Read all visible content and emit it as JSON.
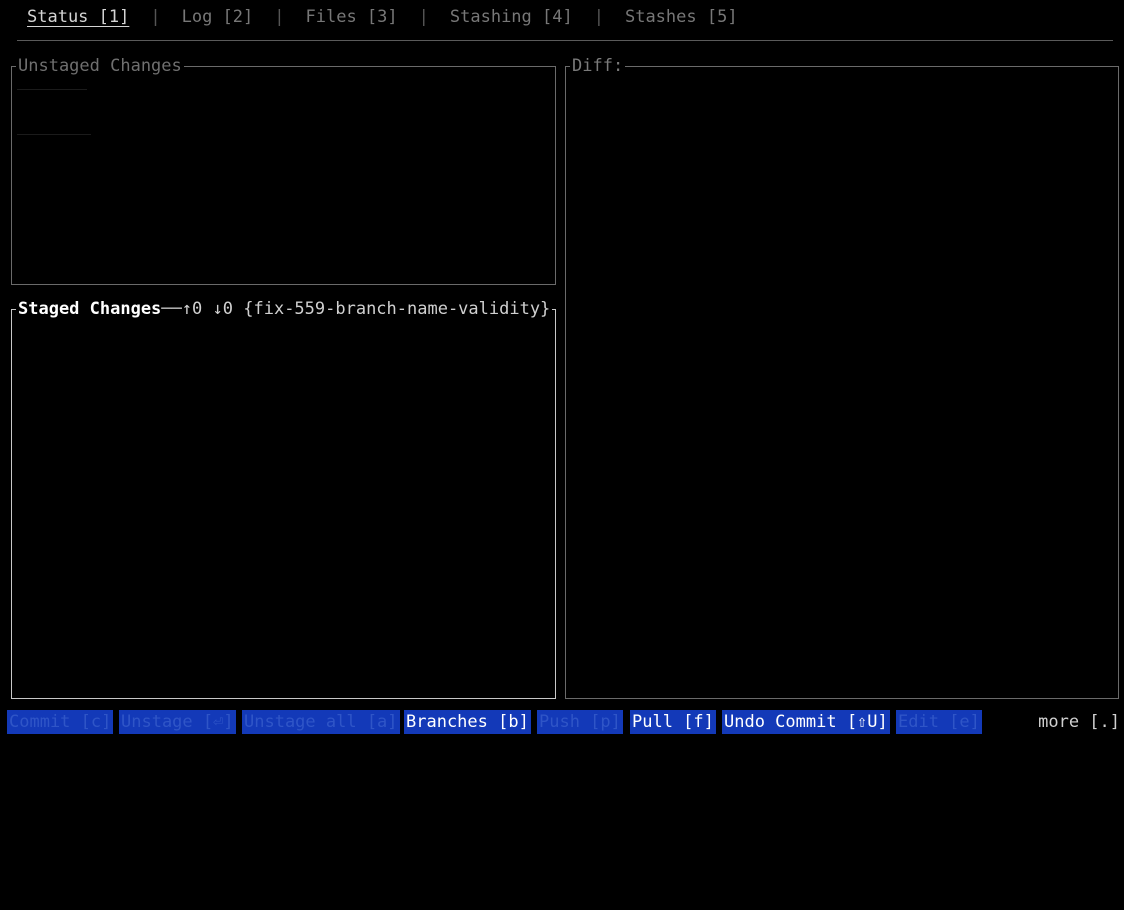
{
  "tabs": [
    {
      "label": "Status [1]"
    },
    {
      "label": "Log [2]"
    },
    {
      "label": "Files [3]"
    },
    {
      "label": "Stashing [4]"
    },
    {
      "label": "Stashes [5]"
    }
  ],
  "tab_separator": "|",
  "panes": {
    "unstaged": {
      "title": "Unstaged Changes"
    },
    "staged": {
      "title": "Staged Changes",
      "separator": "──",
      "ahead": "↑0",
      "behind": "↓0",
      "branch": "{fix-559-branch-name-validity}"
    },
    "diff": {
      "title": "Diff:"
    }
  },
  "keybar": {
    "commit": "Commit [c]",
    "unstage": "Unstage [⏎]",
    "unstage_all": "Unstage all [a]",
    "branches": "Branches [b]",
    "push": "Push [p]",
    "pull": "Pull [f]",
    "undo_commit": "Undo Commit [⇧U]",
    "edit": "Edit [e]",
    "more": "more [.]"
  },
  "colors": {
    "background": "#000000",
    "key_bg": "#1339b8",
    "key_enabled_text": "#ffffff",
    "key_disabled_text": "#2f55c7"
  }
}
